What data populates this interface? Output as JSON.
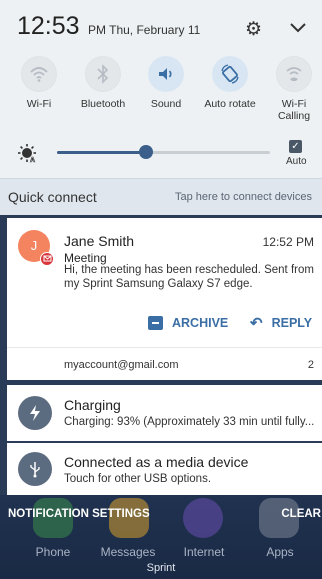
{
  "status": {
    "time": "12:53",
    "suffix": "PM Thu, February 11"
  },
  "quick_settings": [
    {
      "label": "Wi-Fi",
      "icon": "wifi-icon",
      "state": "off"
    },
    {
      "label": "Bluetooth",
      "icon": "bluetooth-icon",
      "state": "off"
    },
    {
      "label": "Sound",
      "icon": "sound-icon",
      "state": "on"
    },
    {
      "label": "Auto rotate",
      "icon": "auto-rotate-icon",
      "state": "on"
    },
    {
      "label": "Wi-Fi Calling",
      "icon": "wifi-calling-icon",
      "state": "off"
    }
  ],
  "brightness": {
    "level": 0.42,
    "auto_label": "Auto",
    "auto_checked": true
  },
  "quick_connect": {
    "title": "Quick connect",
    "hint": "Tap here to connect devices"
  },
  "notifications": {
    "email": {
      "avatar_initial": "J",
      "sender": "Jane Smith",
      "time": "12:52 PM",
      "subject": "Meeting",
      "body": "Hi,  the meeting has been rescheduled. Sent from my Sprint Samsung Galaxy S7 edge.",
      "archive_label": "ARCHIVE",
      "reply_label": "REPLY",
      "account": "myaccount@gmail.com",
      "count": "2"
    },
    "charging": {
      "title": "Charging",
      "body": "Charging: 93% (Approximately 33 min until fully..."
    },
    "usb": {
      "title": "Connected as a media device",
      "body": "Touch for other USB options."
    }
  },
  "footer": {
    "settings_label": "NOTIFICATION SETTINGS",
    "clear_label": "CLEAR"
  },
  "home": {
    "dock": [
      "Phone",
      "Messages",
      "Internet",
      "Apps"
    ],
    "carrier": "Sprint"
  },
  "colors": {
    "accent": "#3a6ea5",
    "avatar": "#f4845f",
    "panel": "#edf1f3"
  }
}
